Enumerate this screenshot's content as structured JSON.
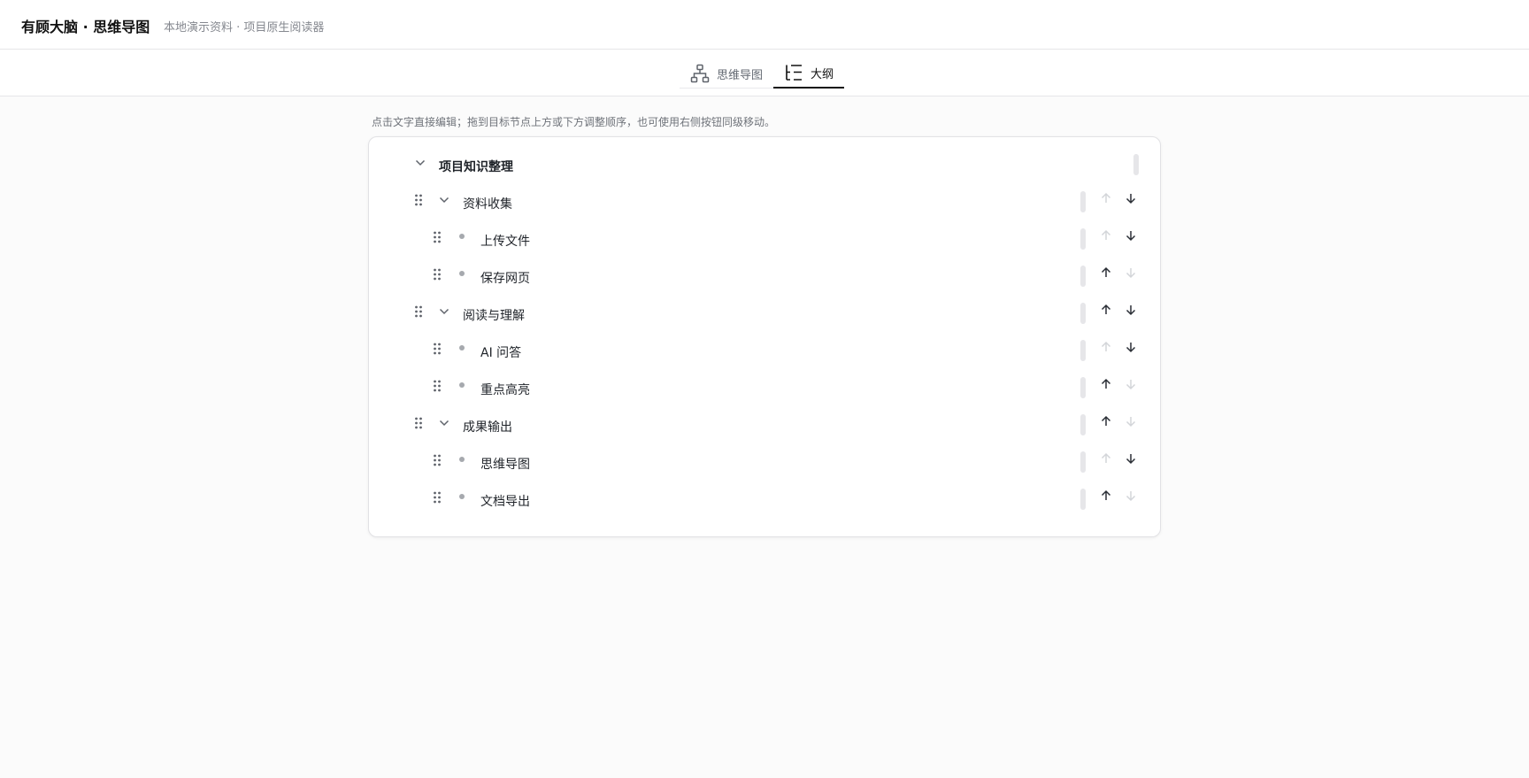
{
  "header": {
    "title": "有顾大脑 · 思维导图",
    "subtitle": "本地演示资料 · 项目原生阅读器"
  },
  "tabs": [
    {
      "label": "思维导图",
      "icon": "mindmap-icon",
      "active": false
    },
    {
      "label": "大纲",
      "icon": "outline-icon",
      "active": true
    }
  ],
  "hint": "点击文字直接编辑；拖到目标节点上方或下方调整顺序，也可使用右侧按钮同级移动。",
  "outline": {
    "root": "项目知识整理",
    "groups": [
      {
        "label": "资料收集",
        "items": [
          "上传文件",
          "保存网页"
        ]
      },
      {
        "label": "阅读与理解",
        "items": [
          "AI 问答",
          "重点高亮"
        ]
      },
      {
        "label": "成果输出",
        "items": [
          "思维导图",
          "文档导出"
        ]
      }
    ]
  },
  "colors": {
    "accent": "#111111",
    "arrow_enabled": "#2b2f36",
    "arrow_disabled": "#d3d5d9",
    "muted_text": "#85888f"
  }
}
